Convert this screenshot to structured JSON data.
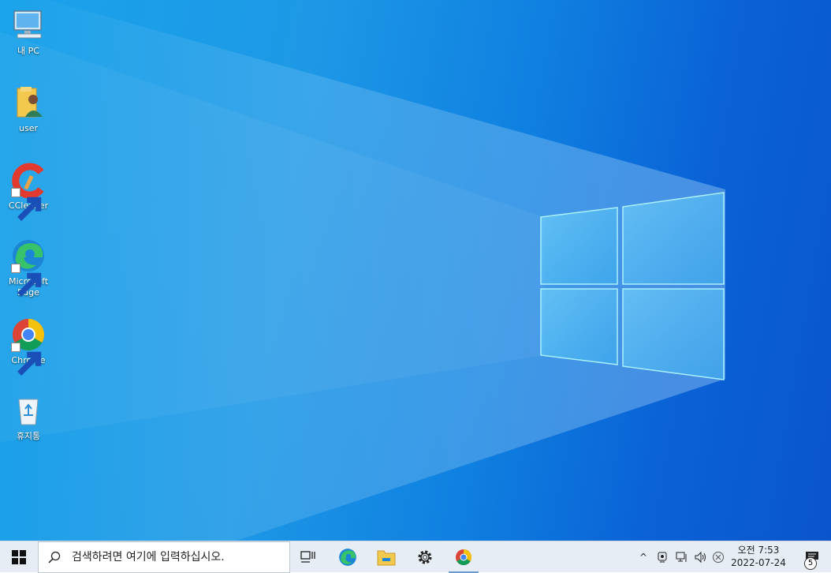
{
  "desktop": {
    "icons": [
      {
        "label": "내 PC",
        "icon": "pc-icon"
      },
      {
        "label": "user",
        "icon": "user-folder-icon"
      },
      {
        "label": "CCleaner",
        "icon": "ccleaner-icon"
      },
      {
        "label": "Microsoft Edge",
        "icon": "edge-icon"
      },
      {
        "label": "Chrome",
        "icon": "chrome-icon"
      },
      {
        "label": "휴지통",
        "icon": "recycle-bin-icon"
      }
    ],
    "wallpaper": "windows-10-default",
    "colors": {
      "accent": "#1aa3ea",
      "deep": "#0a55cc"
    }
  },
  "taskbar": {
    "search_placeholder": "검색하려면 여기에 입력하십시오.",
    "apps": [
      {
        "name": "task-view",
        "icon": "task-view-icon"
      },
      {
        "name": "edge",
        "icon": "edge-icon"
      },
      {
        "name": "file-explorer",
        "icon": "folder-icon"
      },
      {
        "name": "settings",
        "icon": "gear-icon"
      },
      {
        "name": "chrome",
        "icon": "chrome-icon",
        "active": true
      }
    ],
    "tray": {
      "chevron": "^",
      "clock_time": "오전 7:53",
      "clock_date": "2022-07-24",
      "notifications_count": "5"
    }
  }
}
